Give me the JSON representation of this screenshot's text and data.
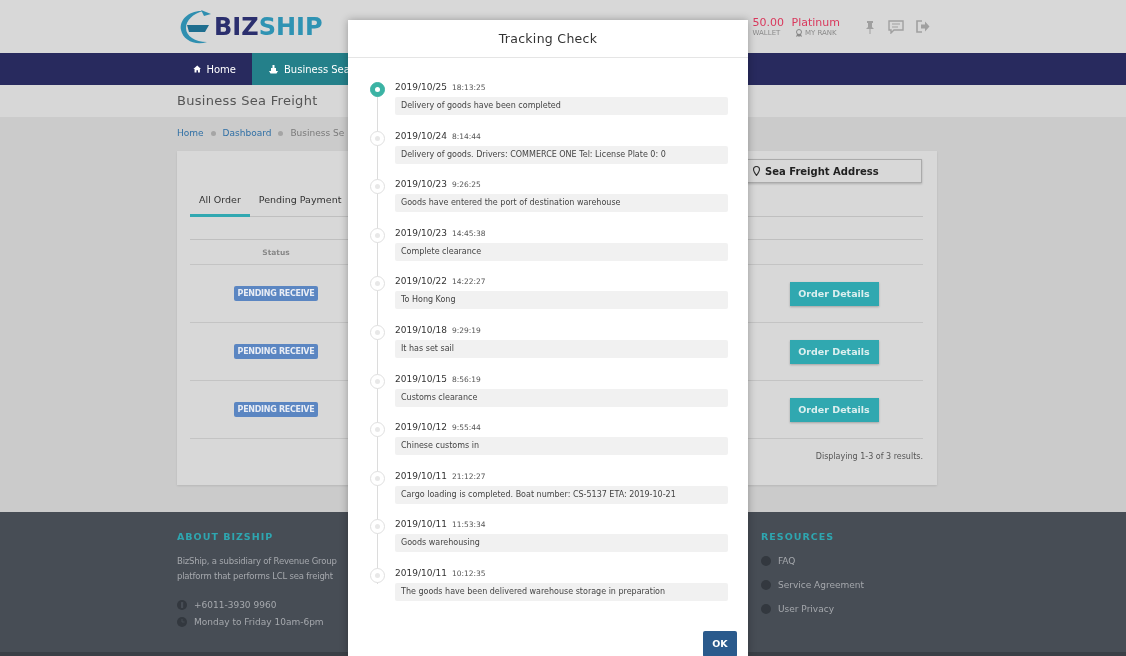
{
  "header": {
    "logo": {
      "part_1": "BIZ",
      "part_2": "SHIP"
    },
    "wallet": {
      "amount": "50.00",
      "label": "WALLET"
    },
    "rank": {
      "value": "Platinum",
      "label": "MY RANK"
    }
  },
  "nav": [
    {
      "label": "Home",
      "selected": false
    },
    {
      "label": "Business Sea",
      "selected": true
    }
  ],
  "page_title": "Business Sea Freight",
  "breadcrumb": [
    "Home",
    "Dashboard",
    "Business Se"
  ],
  "address_button": "Sea Freight Address",
  "tabs": [
    {
      "label": "All Order",
      "selected": true
    },
    {
      "label": "Pending Payment",
      "selected": false
    }
  ],
  "table": {
    "columns": [
      "Status"
    ],
    "rows": [
      {
        "status": "PENDING RECEIVE",
        "action": "Order Details"
      },
      {
        "status": "PENDING RECEIVE",
        "action": "Order Details"
      },
      {
        "status": "PENDING RECEIVE",
        "action": "Order Details"
      }
    ],
    "summary": "Displaying 1-3 of 3 results."
  },
  "footer": {
    "about": {
      "heading": "ABOUT BIZSHIP",
      "lines": [
        "BizShip, a subsidiary of Revenue Group",
        "platform that performs LCL sea freight"
      ],
      "contacts": [
        {
          "kind": "phone",
          "text": "+6011-3930 9960"
        },
        {
          "kind": "clock",
          "text": "Monday to Friday 10am-6pm"
        }
      ]
    },
    "resources": {
      "heading": "RESOURCES",
      "links": [
        "FAQ",
        "Service Agreement",
        "User Privacy"
      ]
    }
  },
  "dialog": {
    "title": "Tracking Check",
    "ok": "OK",
    "events": [
      {
        "date": "2019/10/25",
        "time": "18:13:25",
        "text": "Delivery of goods have been completed",
        "current": true
      },
      {
        "date": "2019/10/24",
        "time": "8:14:44",
        "text": "Delivery of goods. Drivers: COMMERCE ONE Tel: License Plate 0: 0",
        "current": false
      },
      {
        "date": "2019/10/23",
        "time": "9:26:25",
        "text": "Goods have entered the port of destination warehouse",
        "current": false
      },
      {
        "date": "2019/10/23",
        "time": "14:45:38",
        "text": "Complete clearance",
        "current": false
      },
      {
        "date": "2019/10/22",
        "time": "14:22:27",
        "text": "To Hong Kong",
        "current": false
      },
      {
        "date": "2019/10/18",
        "time": "9:29:19",
        "text": "It has set sail",
        "current": false
      },
      {
        "date": "2019/10/15",
        "time": "8:56:19",
        "text": "Customs clearance",
        "current": false
      },
      {
        "date": "2019/10/12",
        "time": "9:55:44",
        "text": "Chinese customs in",
        "current": false
      },
      {
        "date": "2019/10/11",
        "time": "21:12:27",
        "text": "Cargo loading is completed. Boat number: CS-5137 ETA: 2019-10-21",
        "current": false
      },
      {
        "date": "2019/10/11",
        "time": "11:53:34",
        "text": "Goods warehousing",
        "current": false
      },
      {
        "date": "2019/10/11",
        "time": "10:12:35",
        "text": "The goods have been delivered warehouse storage in preparation",
        "current": false
      }
    ]
  }
}
